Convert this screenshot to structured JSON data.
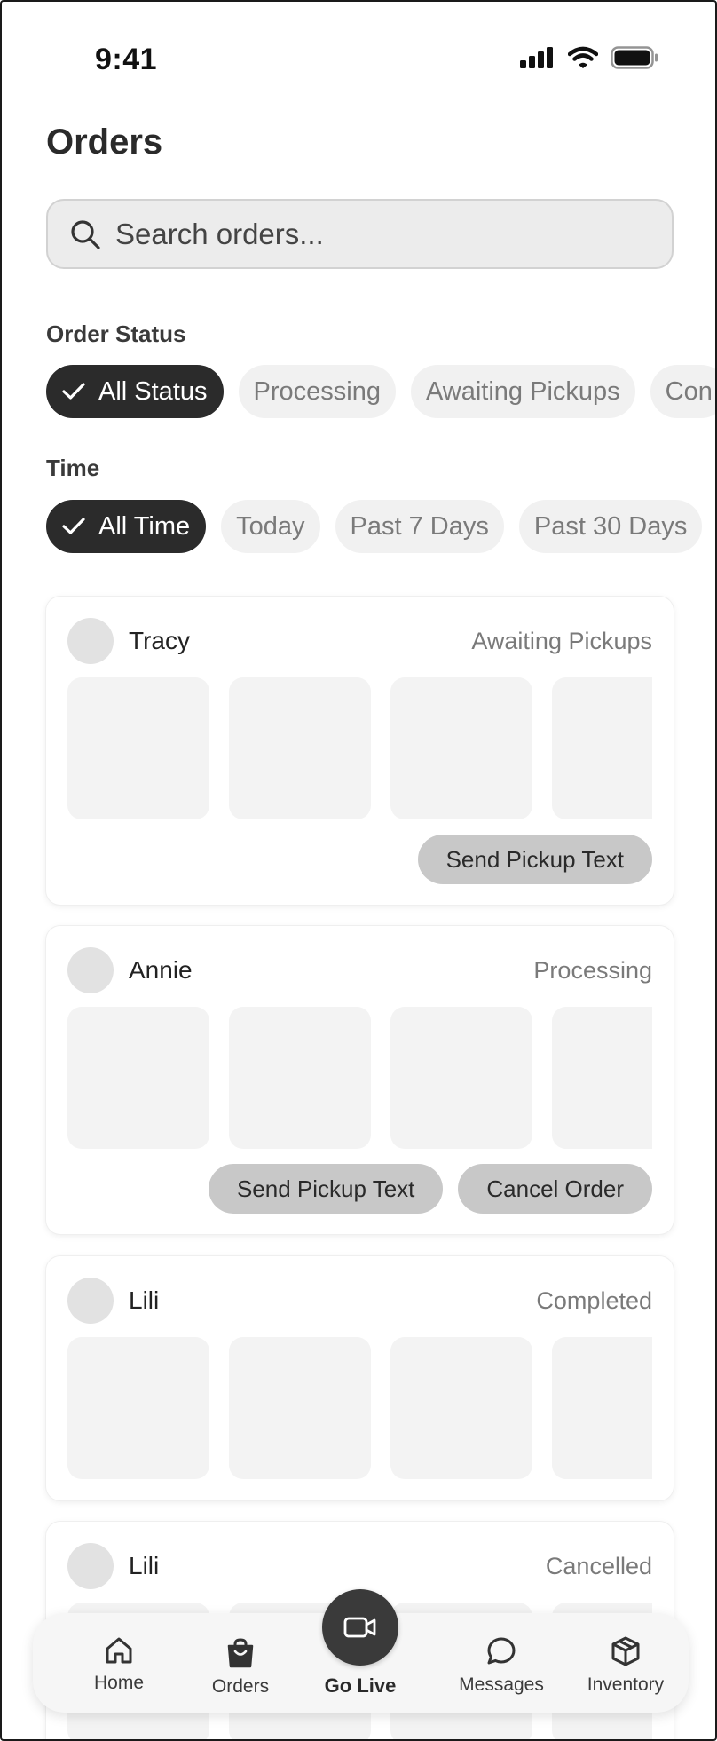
{
  "status_bar": {
    "time": "9:41"
  },
  "page": {
    "title": "Orders"
  },
  "search": {
    "placeholder": "Search orders..."
  },
  "filters": {
    "order_status": {
      "label": "Order Status",
      "options": [
        "All Status",
        "Processing",
        "Awaiting Pickups",
        "Con"
      ],
      "selected": "All Status"
    },
    "time": {
      "label": "Time",
      "options": [
        "All Time",
        "Today",
        "Past 7 Days",
        "Past 30 Days"
      ],
      "selected": "All Time"
    }
  },
  "orders": [
    {
      "customer": "Tracy",
      "status": "Awaiting Pickups",
      "actions": [
        "Send Pickup Text"
      ]
    },
    {
      "customer": "Annie",
      "status": "Processing",
      "actions": [
        "Send Pickup Text",
        "Cancel Order"
      ]
    },
    {
      "customer": "Lili",
      "status": "Completed",
      "actions": []
    },
    {
      "customer": "Lili",
      "status": "Cancelled",
      "actions": []
    }
  ],
  "tab_bar": {
    "home": "Home",
    "orders": "Orders",
    "go_live": "Go Live",
    "messages": "Messages",
    "inventory": "Inventory"
  },
  "icons": {
    "search": "search-icon",
    "check": "check-icon",
    "home": "home-icon",
    "orders": "shopping-bag-icon",
    "go_live": "video-camera-icon",
    "messages": "chat-bubble-icon",
    "inventory": "box-icon"
  },
  "colors": {
    "chip_active_bg": "#2b2b2b",
    "chip_bg": "#f1f1f1",
    "button_bg": "#c8c8c8",
    "go_live_bg": "#3a3a3a"
  }
}
